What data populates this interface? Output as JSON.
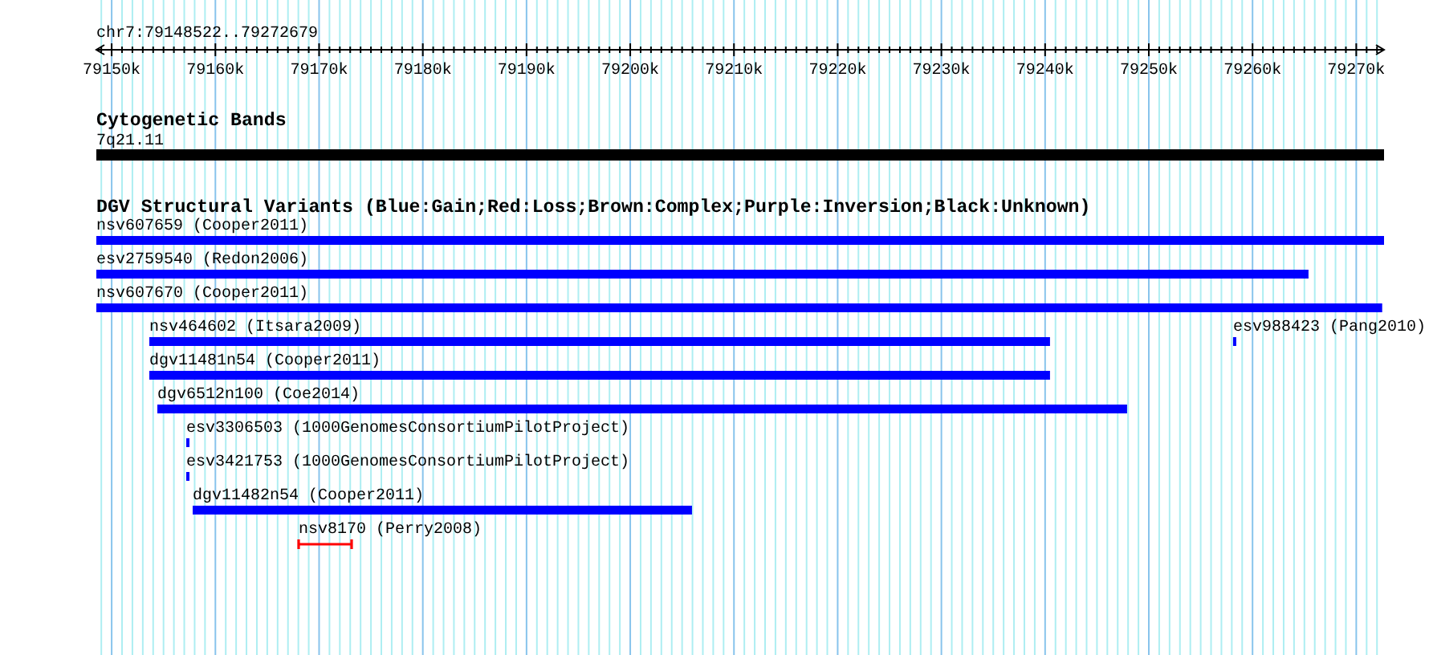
{
  "ruler": {
    "title": "chr7:79148522..79272679",
    "tick_labels": [
      "79150k",
      "79160k",
      "79170k",
      "79180k",
      "79190k",
      "79200k",
      "79210k",
      "79220k",
      "79230k",
      "79240k",
      "79250k",
      "79260k",
      "79270k"
    ]
  },
  "cytogenetic_bands": {
    "title": "Cytogenetic Bands",
    "band": {
      "label": "7q21.11"
    }
  },
  "dgv_track": {
    "title": "DGV Structural Variants (Blue:Gain;Red:Loss;Brown:Complex;Purple:Inversion;Black:Unknown)",
    "rows": [
      {
        "features": [
          {
            "name": "nsv607659 (Cooper2011)",
            "kind": "gain"
          }
        ]
      },
      {
        "features": [
          {
            "name": "esv2759540 (Redon2006)",
            "kind": "gain"
          }
        ]
      },
      {
        "features": [
          {
            "name": "nsv607670 (Cooper2011)",
            "kind": "gain"
          }
        ]
      },
      {
        "features": [
          {
            "name": "nsv464602 (Itsara2009)",
            "kind": "gain"
          },
          {
            "name": "esv988423 (Pang2010)",
            "kind": "gain"
          }
        ]
      },
      {
        "features": [
          {
            "name": "dgv11481n54 (Cooper2011)",
            "kind": "gain"
          }
        ]
      },
      {
        "features": [
          {
            "name": "dgv6512n100 (Coe2014)",
            "kind": "gain"
          }
        ]
      },
      {
        "features": [
          {
            "name": "esv3306503 (1000GenomesConsortiumPilotProject)",
            "kind": "gain"
          }
        ]
      },
      {
        "features": [
          {
            "name": "esv3421753 (1000GenomesConsortiumPilotProject)",
            "kind": "gain"
          }
        ]
      },
      {
        "features": [
          {
            "name": "dgv11482n54 (Cooper2011)",
            "kind": "gain"
          }
        ]
      },
      {
        "features": [
          {
            "name": "nsv8170 (Perry2008)",
            "kind": "loss"
          }
        ]
      }
    ]
  }
}
